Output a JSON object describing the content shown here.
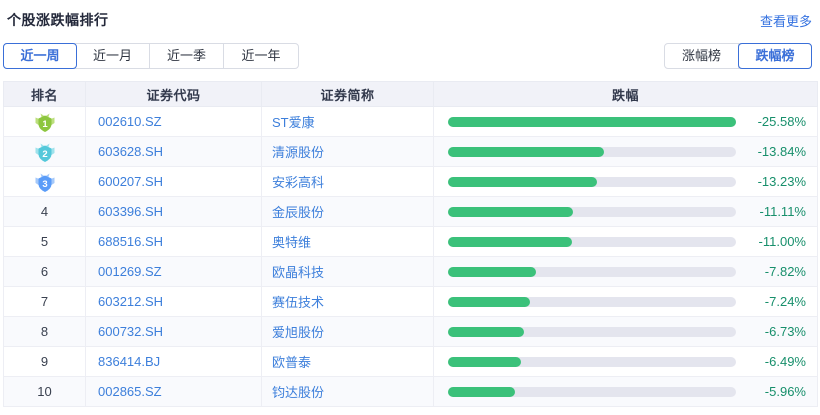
{
  "header": {
    "title": "个股涨跌幅排行",
    "more_link": "查看更多"
  },
  "period_tabs": [
    {
      "label": "近一周",
      "selected": true
    },
    {
      "label": "近一月",
      "selected": false
    },
    {
      "label": "近一季",
      "selected": false
    },
    {
      "label": "近一年",
      "selected": false
    }
  ],
  "rank_toggle": [
    {
      "label": "涨幅榜",
      "selected": false
    },
    {
      "label": "跌幅榜",
      "selected": true
    }
  ],
  "table": {
    "columns": [
      "排名",
      "证券代码",
      "证券简称",
      "跌幅"
    ],
    "max_value": 25.58,
    "rows": [
      {
        "rank": 1,
        "code": "002610.SZ",
        "name": "ST爱康",
        "pct": "-25.58%",
        "value": 25.58
      },
      {
        "rank": 2,
        "code": "603628.SH",
        "name": "清源股份",
        "pct": "-13.84%",
        "value": 13.84
      },
      {
        "rank": 3,
        "code": "600207.SH",
        "name": "安彩高科",
        "pct": "-13.23%",
        "value": 13.23
      },
      {
        "rank": 4,
        "code": "603396.SH",
        "name": "金辰股份",
        "pct": "-11.11%",
        "value": 11.11
      },
      {
        "rank": 5,
        "code": "688516.SH",
        "name": "奥特维",
        "pct": "-11.00%",
        "value": 11.0
      },
      {
        "rank": 6,
        "code": "001269.SZ",
        "name": "欧晶科技",
        "pct": "-7.82%",
        "value": 7.82
      },
      {
        "rank": 7,
        "code": "603212.SH",
        "name": "赛伍技术",
        "pct": "-7.24%",
        "value": 7.24
      },
      {
        "rank": 8,
        "code": "600732.SH",
        "name": "爱旭股份",
        "pct": "-6.73%",
        "value": 6.73
      },
      {
        "rank": 9,
        "code": "836414.BJ",
        "name": "欧普泰",
        "pct": "-6.49%",
        "value": 6.49
      },
      {
        "rank": 10,
        "code": "002865.SZ",
        "name": "钧达股份",
        "pct": "-5.96%",
        "value": 5.96
      }
    ]
  },
  "medal_colors": {
    "1": {
      "main": "#8dc63f",
      "light": "#bcdf7e"
    },
    "2": {
      "main": "#54c8da",
      "light": "#9fe2ec"
    },
    "3": {
      "main": "#5a9cf8",
      "light": "#a5c9fa"
    }
  },
  "colors": {
    "accent_blue": "#3a6fd8",
    "link_blue": "#3d7fdb",
    "bar_green": "#3bc17a",
    "bar_track": "#e4e5ee",
    "pct_green": "#178f6b",
    "header_bg": "#f1f2f8"
  }
}
